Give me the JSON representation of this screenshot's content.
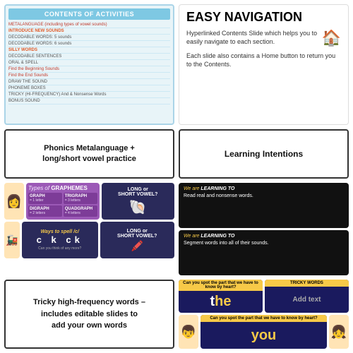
{
  "contents": {
    "title": "CONTENTS OF ACTIVITIES",
    "items": [
      {
        "text": "METALANGUAGE (including types of vowel sounds)",
        "style": "normal"
      },
      {
        "text": "INTRODUCE NEW SOUNDS",
        "style": "highlight"
      },
      {
        "text": "DECODABLE WORDS: 5 sounds",
        "style": "normal"
      },
      {
        "text": "DECODABLE WORDS: 6 sounds",
        "style": "normal"
      },
      {
        "text": "SILLY WORDS",
        "style": "highlight"
      },
      {
        "text": "DECODABLE SENTENCES",
        "style": "normal"
      },
      {
        "text": "ORAL & SPELL",
        "style": "normal"
      },
      {
        "text": "Find the Beginning Sounds",
        "style": "subitem"
      },
      {
        "text": "Find the End Sounds",
        "style": "subitem"
      },
      {
        "text": "DRAW THE SOUND",
        "style": "normal"
      },
      {
        "text": "PHONEME BOXES",
        "style": "normal"
      },
      {
        "text": "TRICKY (HI-FREQUENCY) And & Nonsense Words",
        "style": "normal"
      },
      {
        "text": "BONUS SOUND",
        "style": "normal"
      }
    ]
  },
  "easy_nav": {
    "title": "EASY NAVIGATION",
    "paragraph1": "Hyperlinked Contents Slide which helps you to easily navigate to each section.",
    "paragraph2": "Each slide also contains a Home button to return you to the Contents.",
    "icon": "🏠"
  },
  "phonics": {
    "title": "Phonics Metalanguage +\nlong/short vowel practice"
  },
  "learning": {
    "title": "Learning Intentions"
  },
  "graphemes": {
    "section_title": "Types of GRAPHEMES",
    "long_short": "LONG or SHORT VOWEL?",
    "long_short2": "LONG or SHORT VOWEL?",
    "graph": {
      "label": "GRAPH",
      "sub": "= 1 letter"
    },
    "digraph": {
      "label": "DIGRAPH",
      "sub": "= 2 letters"
    },
    "trigraph": {
      "label": "TRIGRAPH",
      "sub": "= 3 letters"
    },
    "quadgraph": {
      "label": "QUADGRAPH",
      "sub": "= 4 letters"
    },
    "ways_spell": "Ways to spell /c/",
    "letters": "c  k  ck",
    "small_text": "Can you think of any more?"
  },
  "learning_cards": [
    {
      "heading_pre": "We are",
      "heading_bold": "LEARNING TO",
      "body": "Read real and nonsense words."
    },
    {
      "heading_pre": "We are",
      "heading_bold": "LEARNING TO",
      "body": "Segment words into all of their sounds."
    }
  ],
  "tricky_section": {
    "text": "Tricky high-frequency words –\nincludes editable slides to\nadd your own words"
  },
  "tricky_cards": [
    {
      "header": "Can you spot the part that we have to know by heart?",
      "word_pre": "",
      "word_main": "the",
      "word_highlight": ""
    },
    {
      "header": "TRICKY WORDS",
      "word_pre": "",
      "word_main": "Add text",
      "word_highlight": ""
    },
    {
      "header": "Can you spot the part that we have to know by heart?",
      "word_pre": "",
      "word_main": "you",
      "word_highlight": ""
    }
  ],
  "tricky_headers": {
    "left": "TRICKY WORDS",
    "right": "TRICKY WORDS"
  }
}
